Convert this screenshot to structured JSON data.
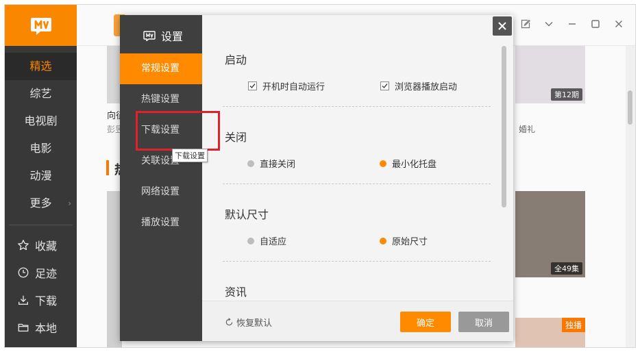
{
  "sidebar": {
    "items": [
      {
        "label": "精选",
        "active": true
      },
      {
        "label": "综艺"
      },
      {
        "label": "电视剧"
      },
      {
        "label": "电影"
      },
      {
        "label": "动漫"
      },
      {
        "label": "更多",
        "more": true
      }
    ],
    "bottom_items": [
      {
        "label": "收藏",
        "icon": "star-icon"
      },
      {
        "label": "足迹",
        "icon": "clock-icon"
      },
      {
        "label": "下载",
        "icon": "download-icon"
      },
      {
        "label": "本地",
        "icon": "folder-icon"
      }
    ],
    "more_arrow": "›"
  },
  "background": {
    "card_title_1": "向征",
    "card_sub_1": "彭昱",
    "card_sub_2": "婚礼",
    "badge_episode": "第12期",
    "badge_episodes": "全49集",
    "badge_exclusive": "独播",
    "section_initial": "热"
  },
  "dialog": {
    "title": "设置",
    "menu": [
      {
        "label": "常规设置",
        "active": true
      },
      {
        "label": "热键设置"
      },
      {
        "label": "下载设置"
      },
      {
        "label": "关联设置"
      },
      {
        "label": "网络设置"
      },
      {
        "label": "播放设置"
      }
    ],
    "tooltip": "下载设置",
    "sections": {
      "startup": {
        "title": "启动",
        "opt1": "开机时自动运行",
        "opt2": "浏览器播放启动"
      },
      "close": {
        "title": "关闭",
        "opt1": "直接关闭",
        "opt2": "最小化托盘"
      },
      "default_size": {
        "title": "默认尺寸",
        "opt1": "自适应",
        "opt2": "原始尺寸"
      },
      "news": {
        "title": "资讯"
      }
    },
    "footer": {
      "restore": "恢复默认",
      "ok": "确定",
      "cancel": "取消"
    }
  },
  "colors": {
    "brand": "#ff8a00",
    "sidebar_bg": "#3a3a3a",
    "highlight": "#e0202a"
  }
}
